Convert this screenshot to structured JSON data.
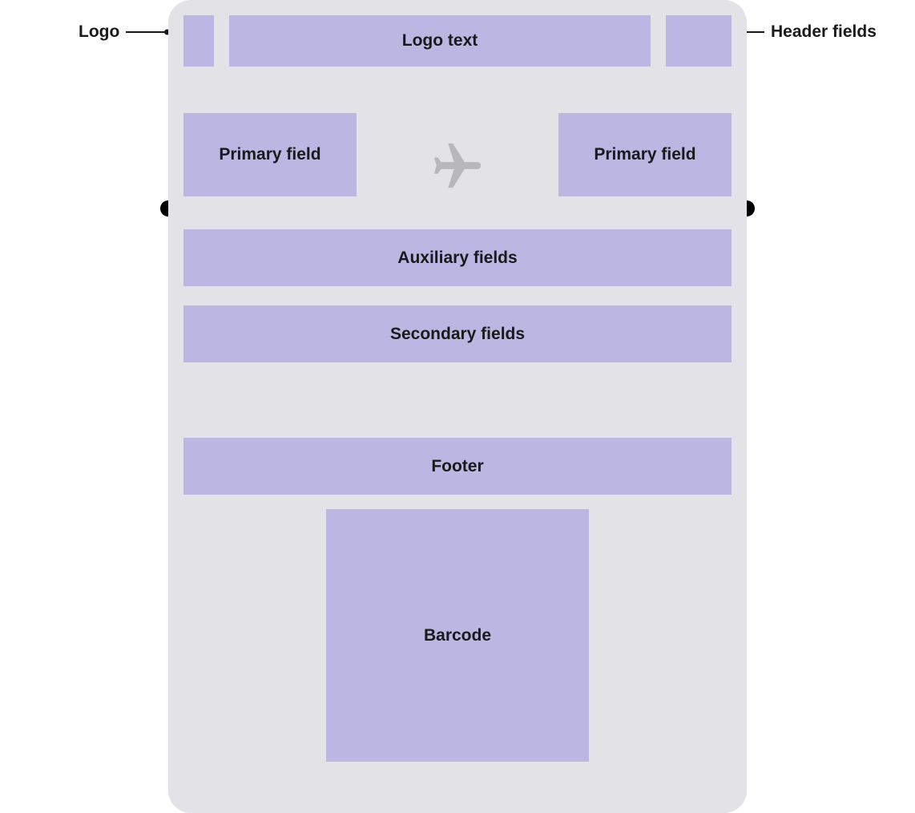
{
  "callouts": {
    "logo": "Logo",
    "header_fields": "Header fields"
  },
  "pass": {
    "logo_text": "Logo text",
    "primary_field_left": "Primary field",
    "primary_field_right": "Primary field",
    "auxiliary_fields": "Auxiliary fields",
    "secondary_fields": "Secondary fields",
    "footer": "Footer",
    "barcode": "Barcode"
  },
  "colors": {
    "card_background": "#e3e3e7",
    "box_fill": "#bbb6e2",
    "icon_fill": "#b7b7bc",
    "text": "#1a1a1a"
  }
}
